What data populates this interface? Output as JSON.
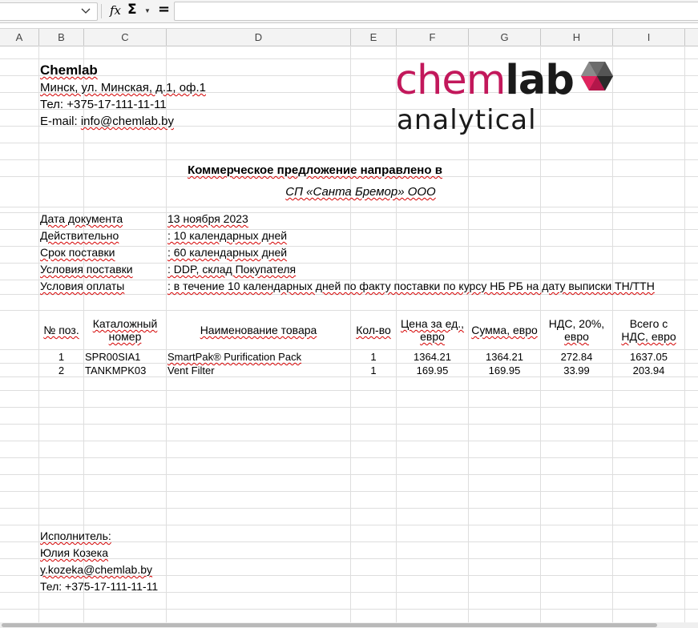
{
  "toolbar": {
    "name_box": "",
    "formula": "",
    "fx_label": "fx",
    "sigma_label": "Σ",
    "equals_label": "="
  },
  "columns": [
    "A",
    "B",
    "C",
    "D",
    "E",
    "F",
    "G",
    "H",
    "I"
  ],
  "company": {
    "name": "Chemlab",
    "address": "Минск, ул. Минская, д.1, оф.1",
    "phone": "Тел: +375-17-111-11-11",
    "email_label": "E-mail:",
    "email": "info@chemlab.by"
  },
  "logo": {
    "chem": "chem",
    "lab": "lab",
    "analytical": "analytical",
    "colors": {
      "chem": "#c2185b",
      "lab": "#1a1a1a",
      "analytical": "#1a1a1a",
      "cube_pink": "#e0245e",
      "cube_gray": "#555555",
      "cube_dark": "#2a2a2a"
    }
  },
  "offer": {
    "title": "Коммерческое предложение направлено в",
    "recipient": "СП «Санта Бремор» ООО"
  },
  "terms": [
    {
      "label": "Дата документа",
      "value": "13 ноября 2023"
    },
    {
      "label": "Действительно",
      "value": ": 10 календарных дней"
    },
    {
      "label": "Срок поставки",
      "value": ": 60 календарных дней"
    },
    {
      "label": "Условия поставки",
      "value": ": DDP, склад Покупателя"
    },
    {
      "label": "Условия оплаты",
      "value": ": в течение 10 календарных дней по факту поставки по курсу НБ РБ на дату выписки ТН/ТТН"
    }
  ],
  "table": {
    "headers": {
      "num": "№ поз.",
      "catalog_1": "Каталожный",
      "catalog_2": "номер",
      "name": "Наименование товара",
      "qty": "Кол-во",
      "price_1": "Цена за ед.,",
      "price_2": "евро",
      "sum": "Сумма, евро",
      "vat_1": "НДС, 20%,",
      "vat_2": "евро",
      "total_1": "Всего с",
      "total_2": "НДС, евро"
    },
    "rows": [
      {
        "num": "1",
        "catalog": "SPR00SIA1",
        "name": "SmartPak® Purification Pack",
        "qty": "1",
        "price": "1364.21",
        "sum": "1364.21",
        "vat": "272.84",
        "total": "1637.05"
      },
      {
        "num": "2",
        "catalog": "TANKMPK03",
        "name": "Vent Filter",
        "qty": "1",
        "price": "169.95",
        "sum": "169.95",
        "vat": "33.99",
        "total": "203.94"
      }
    ]
  },
  "contact": {
    "label": "Исполнитель:",
    "name": "Юлия Козека",
    "email": "y.kozeka@chemlab.by",
    "phone": "Тел: +375-17-111-11-11"
  }
}
